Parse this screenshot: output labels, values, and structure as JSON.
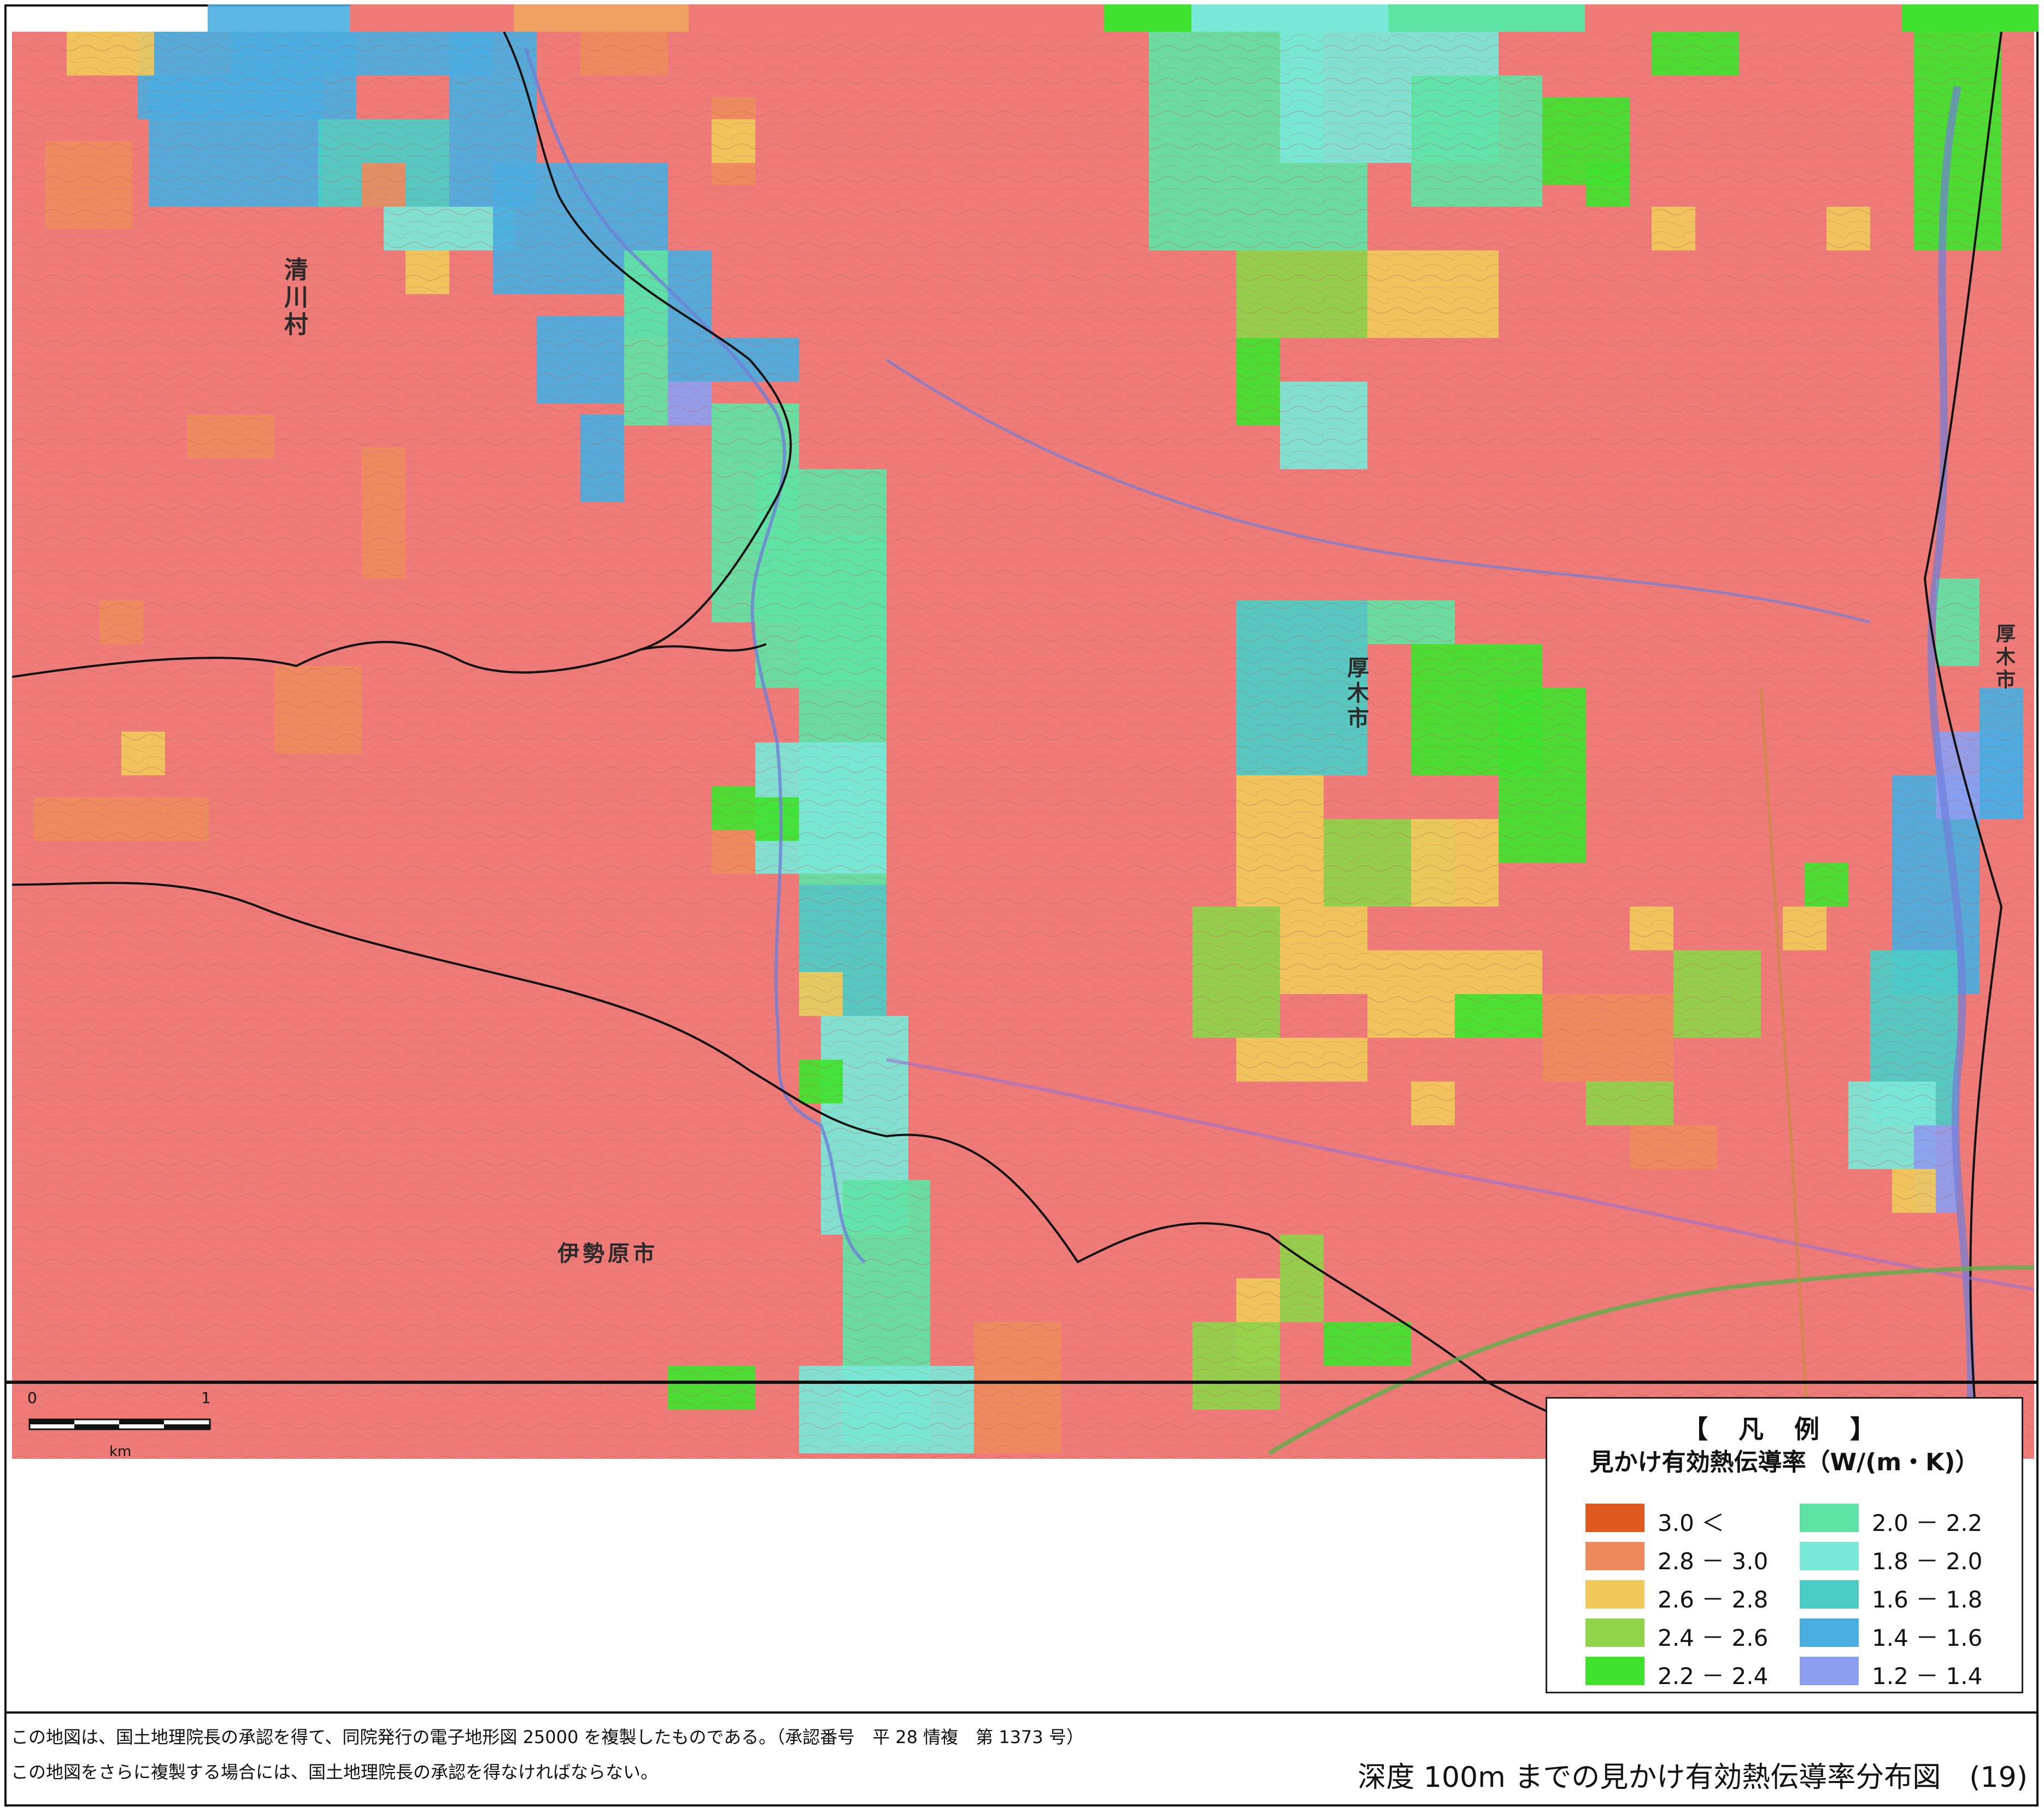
{
  "map": {
    "places": [
      {
        "id": "kiyokawa",
        "text": "清川村"
      },
      {
        "id": "atsugi-center",
        "text": "厚木市"
      },
      {
        "id": "atsugi-right",
        "text": "厚木市"
      },
      {
        "id": "isehara",
        "text": "伊勢原市"
      }
    ],
    "scale": {
      "zero": "0",
      "one": "1",
      "unit": "km"
    }
  },
  "legend": {
    "title": "【 凡 例 】",
    "subtitle": "見かけ有効熱伝導率（W/(m・K)）",
    "items": [
      {
        "label": "3.0 ＜",
        "color": "#e05a1e"
      },
      {
        "label": "2.8 － 3.0",
        "color": "#ef8a5e"
      },
      {
        "label": "2.6 － 2.8",
        "color": "#f0c95a"
      },
      {
        "label": "2.4 － 2.6",
        "color": "#8fd44a"
      },
      {
        "label": "2.2 － 2.4",
        "color": "#3fe32f"
      },
      {
        "label": "2.0 － 2.2",
        "color": "#5fe3a4"
      },
      {
        "label": "1.8 － 2.0",
        "color": "#7ae8d8"
      },
      {
        "label": "1.6 － 1.8",
        "color": "#4bcdc6"
      },
      {
        "label": "1.4 － 1.6",
        "color": "#4aaee0"
      },
      {
        "label": "1.2 － 1.4",
        "color": "#8c9ef0"
      }
    ]
  },
  "footer": {
    "note1": "この地図は、国土地理院長の承認を得て、同院発行の電子地形図 25000 を複製したものである。（承認番号　平 28 情複　第 1373 号）",
    "note2": "この地図をさらに複製する場合には、国土地理院長の承認を得なければならない。",
    "title": "深度 100m までの見かけ有効熱伝導率分布図　(19)"
  }
}
